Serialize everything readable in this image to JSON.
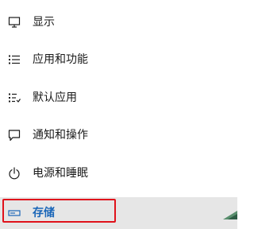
{
  "nav": {
    "items": [
      {
        "label": "显示",
        "icon": "display-icon"
      },
      {
        "label": "应用和功能",
        "icon": "apps-list-icon"
      },
      {
        "label": "默认应用",
        "icon": "default-apps-icon"
      },
      {
        "label": "通知和操作",
        "icon": "notification-icon"
      },
      {
        "label": "电源和睡眠",
        "icon": "power-icon"
      },
      {
        "label": "存储",
        "icon": "storage-icon",
        "selected": true
      }
    ]
  },
  "colors": {
    "selected_text": "#1a66b8",
    "selected_background": "#e6e6e6",
    "highlight_border": "#e0121b",
    "text": "#1a1a1a"
  }
}
